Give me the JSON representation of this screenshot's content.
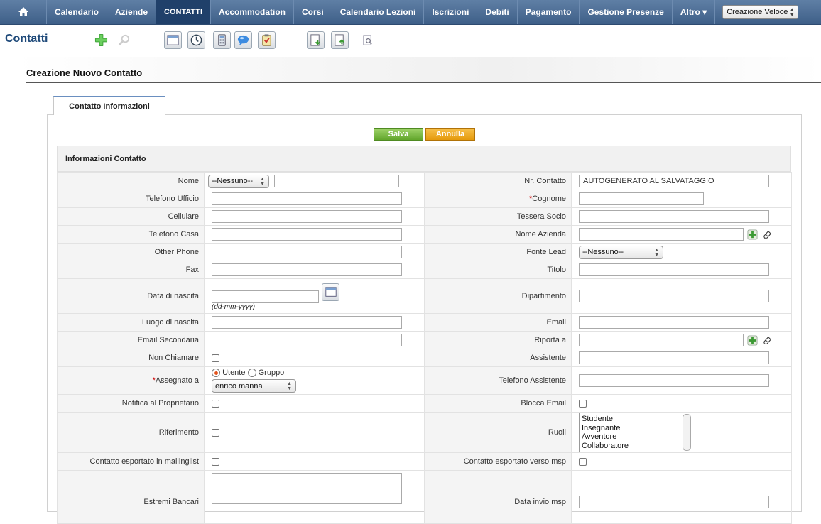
{
  "nav": {
    "items": [
      "Calendario",
      "Aziende",
      "CONTATTI",
      "Accommodation",
      "Corsi",
      "Calendario Lezioni",
      "Iscrizioni",
      "Debiti",
      "Pagamento",
      "Gestione Presenze",
      "Altro ▾"
    ],
    "active_index": 2,
    "quick_create": "Creazione Veloce"
  },
  "module": {
    "title": "Contatti"
  },
  "form": {
    "title": "Creazione Nuovo Contatto",
    "tab": "Contatto Informazioni",
    "save": "Salva",
    "cancel": "Annulla",
    "section": "Informazioni Contatto"
  },
  "fields": {
    "nome": {
      "label": "Nome",
      "salutation": "--Nessuno--",
      "value": ""
    },
    "nr_contatto": {
      "label": "Nr. Contatto",
      "value": "AUTOGENERATO AL SALVATAGGIO"
    },
    "telefono_ufficio": {
      "label": "Telefono Ufficio",
      "value": ""
    },
    "cognome": {
      "label": "Cognome",
      "required_mark": "*",
      "value": ""
    },
    "cellulare": {
      "label": "Cellulare",
      "value": ""
    },
    "tessera_socio": {
      "label": "Tessera Socio",
      "value": ""
    },
    "telefono_casa": {
      "label": "Telefono Casa",
      "value": ""
    },
    "nome_azienda": {
      "label": "Nome Azienda",
      "value": ""
    },
    "other_phone": {
      "label": "Other Phone",
      "value": ""
    },
    "fonte_lead": {
      "label": "Fonte Lead",
      "value": "--Nessuno--"
    },
    "fax": {
      "label": "Fax",
      "value": ""
    },
    "titolo": {
      "label": "Titolo",
      "value": ""
    },
    "data_nascita": {
      "label": "Data di nascita",
      "value": "",
      "hint": "(dd-mm-yyyy)"
    },
    "dipartimento": {
      "label": "Dipartimento",
      "value": ""
    },
    "luogo_nascita": {
      "label": "Luogo di nascita",
      "value": ""
    },
    "email": {
      "label": "Email",
      "value": ""
    },
    "email_secondaria": {
      "label": "Email Secondaria",
      "value": ""
    },
    "riporta_a": {
      "label": "Riporta a",
      "value": ""
    },
    "non_chiamare": {
      "label": "Non Chiamare",
      "checked": false
    },
    "assistente": {
      "label": "Assistente",
      "value": ""
    },
    "assegnato_a": {
      "label": "Assegnato a",
      "required_mark": "*",
      "option_user": "Utente",
      "option_group": "Gruppo",
      "selected": "Utente",
      "user": "enrico manna"
    },
    "telefono_assistente": {
      "label": "Telefono Assistente",
      "value": ""
    },
    "notifica_proprietario": {
      "label": "Notifica al Proprietario",
      "checked": false
    },
    "blocca_email": {
      "label": "Blocca Email",
      "checked": false
    },
    "riferimento": {
      "label": "Riferimento",
      "checked": false
    },
    "ruoli": {
      "label": "Ruoli",
      "options": [
        "Studente",
        "Insegnante",
        "Avventore",
        "Collaboratore"
      ]
    },
    "esportato_mailinglist": {
      "label": "Contatto esportato in mailinglist",
      "checked": false
    },
    "esportato_msp": {
      "label": "Contatto esportato verso msp",
      "checked": false
    },
    "estremi_bancari": {
      "label": "Estremi Bancari",
      "value": ""
    },
    "data_invio_msp": {
      "label": "Data invio msp",
      "value": ""
    }
  },
  "colors": {
    "nav_bg": "#3e5f88",
    "nav_active": "#20406a",
    "save": "#62a62c",
    "cancel": "#e59a0c",
    "required": "#cc0000"
  }
}
